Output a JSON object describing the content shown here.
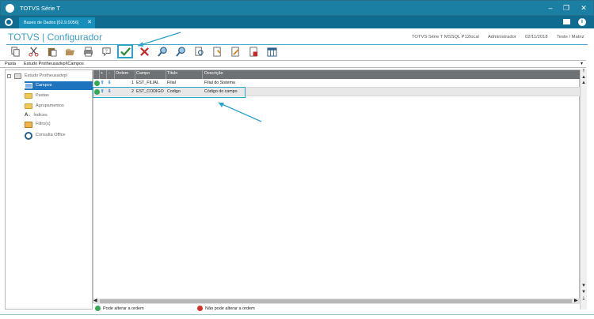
{
  "window": {
    "title": "TOTVS Série T"
  },
  "tabs": [
    {
      "label": "Bases de Dados [02.9.0056]",
      "close": "✕"
    }
  ],
  "header": {
    "app_title": "TOTVS | Configurador",
    "env": "TOTVS Série T  MSSQL P12local",
    "user": "Administrador",
    "date": "02/11/2018",
    "company": "Teste / Matriz"
  },
  "toolbar": {
    "icons": [
      "copy-icon",
      "cut-icon",
      "paste-icon",
      "open-icon",
      "print-icon",
      "help-icon",
      "confirm-icon",
      "cancel-icon",
      "search-icon",
      "search-next-icon",
      "preview-icon",
      "new-icon",
      "edit-icon",
      "delete-icon",
      "table-icon"
    ],
    "highlighted": "confirm-icon"
  },
  "path": {
    "label": "Pasta",
    "value": "Estudo Protheusadvpl\\Campos"
  },
  "tree": {
    "root": "Estudo Protheusadvpl",
    "items": [
      {
        "label": "Campos",
        "selected": true
      },
      {
        "label": "Pastas"
      },
      {
        "label": "Agrupamentos"
      },
      {
        "label": "Índices"
      },
      {
        "label": "Filtro(s)"
      },
      {
        "label": "Consulta Office"
      }
    ]
  },
  "grid": {
    "columns": [
      "",
      "+",
      "-",
      "Ordem",
      "Campo",
      "Título",
      "Descrição"
    ],
    "rows": [
      {
        "ordem": "1",
        "campo": "EST_FILIAL",
        "titulo": "Filial",
        "descricao": "Filial do Sistema"
      },
      {
        "ordem": "2",
        "campo": "EST_CODIGO",
        "titulo": "Codigo",
        "descricao": "Código do campo"
      }
    ]
  },
  "legend": {
    "can_reorder": "Pode alterar a ordem",
    "cannot_reorder": "Não pode alterar a ordem"
  },
  "colors": {
    "title_bar": "#1b7ea3",
    "accent": "#3d9ec6",
    "grid_header": "#6f7275",
    "selected": "#1e73be"
  }
}
